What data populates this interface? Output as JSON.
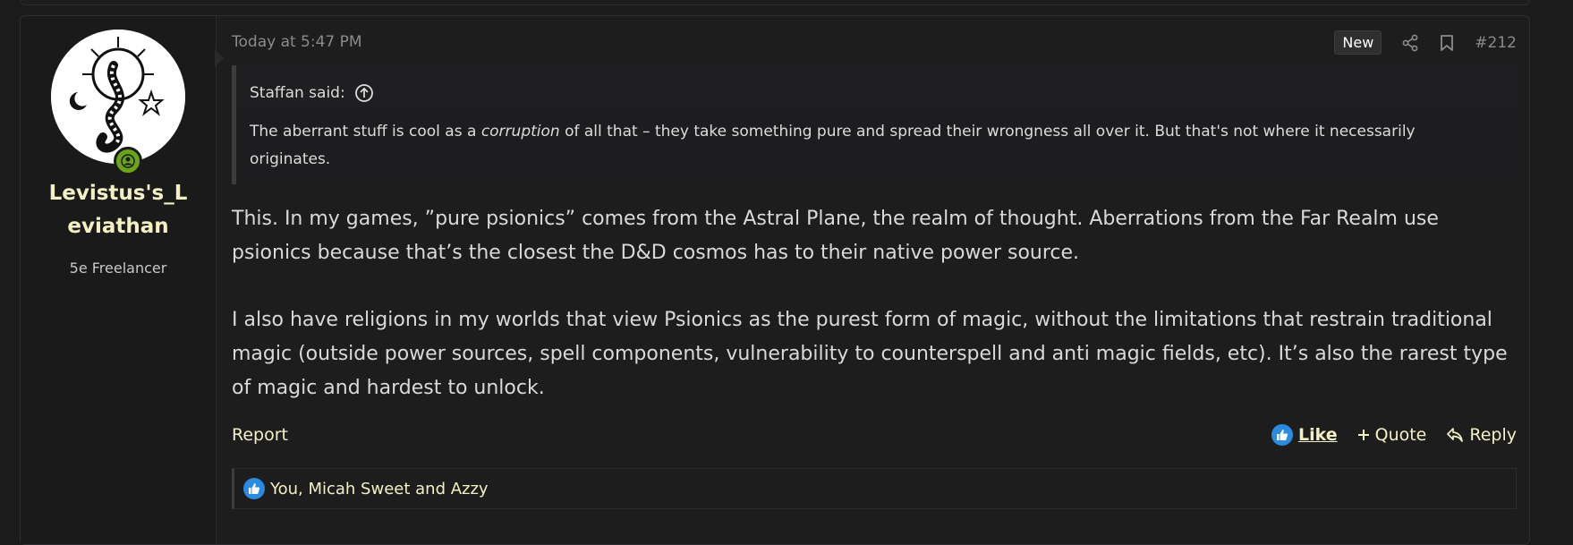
{
  "post": {
    "username": "Levistus's_Leviathan",
    "user_title": "5e Freelancer",
    "date": "Today at 5:47 PM",
    "badge": "New",
    "post_number": "#212",
    "quote": {
      "author": "Staffan said:",
      "text_before": "The aberrant stuff is cool as a ",
      "text_em": "corruption",
      "text_after": " of all that – they take something pure and spread their wrongness all over it. But that's not where it necessarily originates."
    },
    "paragraphs": [
      "This. In my games, ”pure psionics” comes from the Astral Plane, the realm of thought. Aberrations from the Far Realm use psionics because that’s the closest the D&D cosmos has to their native power source.",
      "I also have religions in my worlds that view Psionics as the purest form of magic, without the limitations that restrain traditional magic (outside power sources, spell components, vulnerability to counterspell and anti magic fields, etc). It’s also the rarest type of magic and hardest to unlock."
    ],
    "actions": {
      "report": "Report",
      "like": "Like",
      "quote": "Quote",
      "reply": "Reply"
    },
    "reactions_text": "You, Micah Sweet and Azzy"
  },
  "colors": {
    "background": "#1b1b1c",
    "username": "#f3f0c4",
    "online": "#6aa519",
    "like_blue": "#2b8be0"
  },
  "icons": [
    "share-icon",
    "bookmark-icon",
    "jump-up-icon",
    "like-icon",
    "plus-icon",
    "reply-icon",
    "user-icon"
  ]
}
